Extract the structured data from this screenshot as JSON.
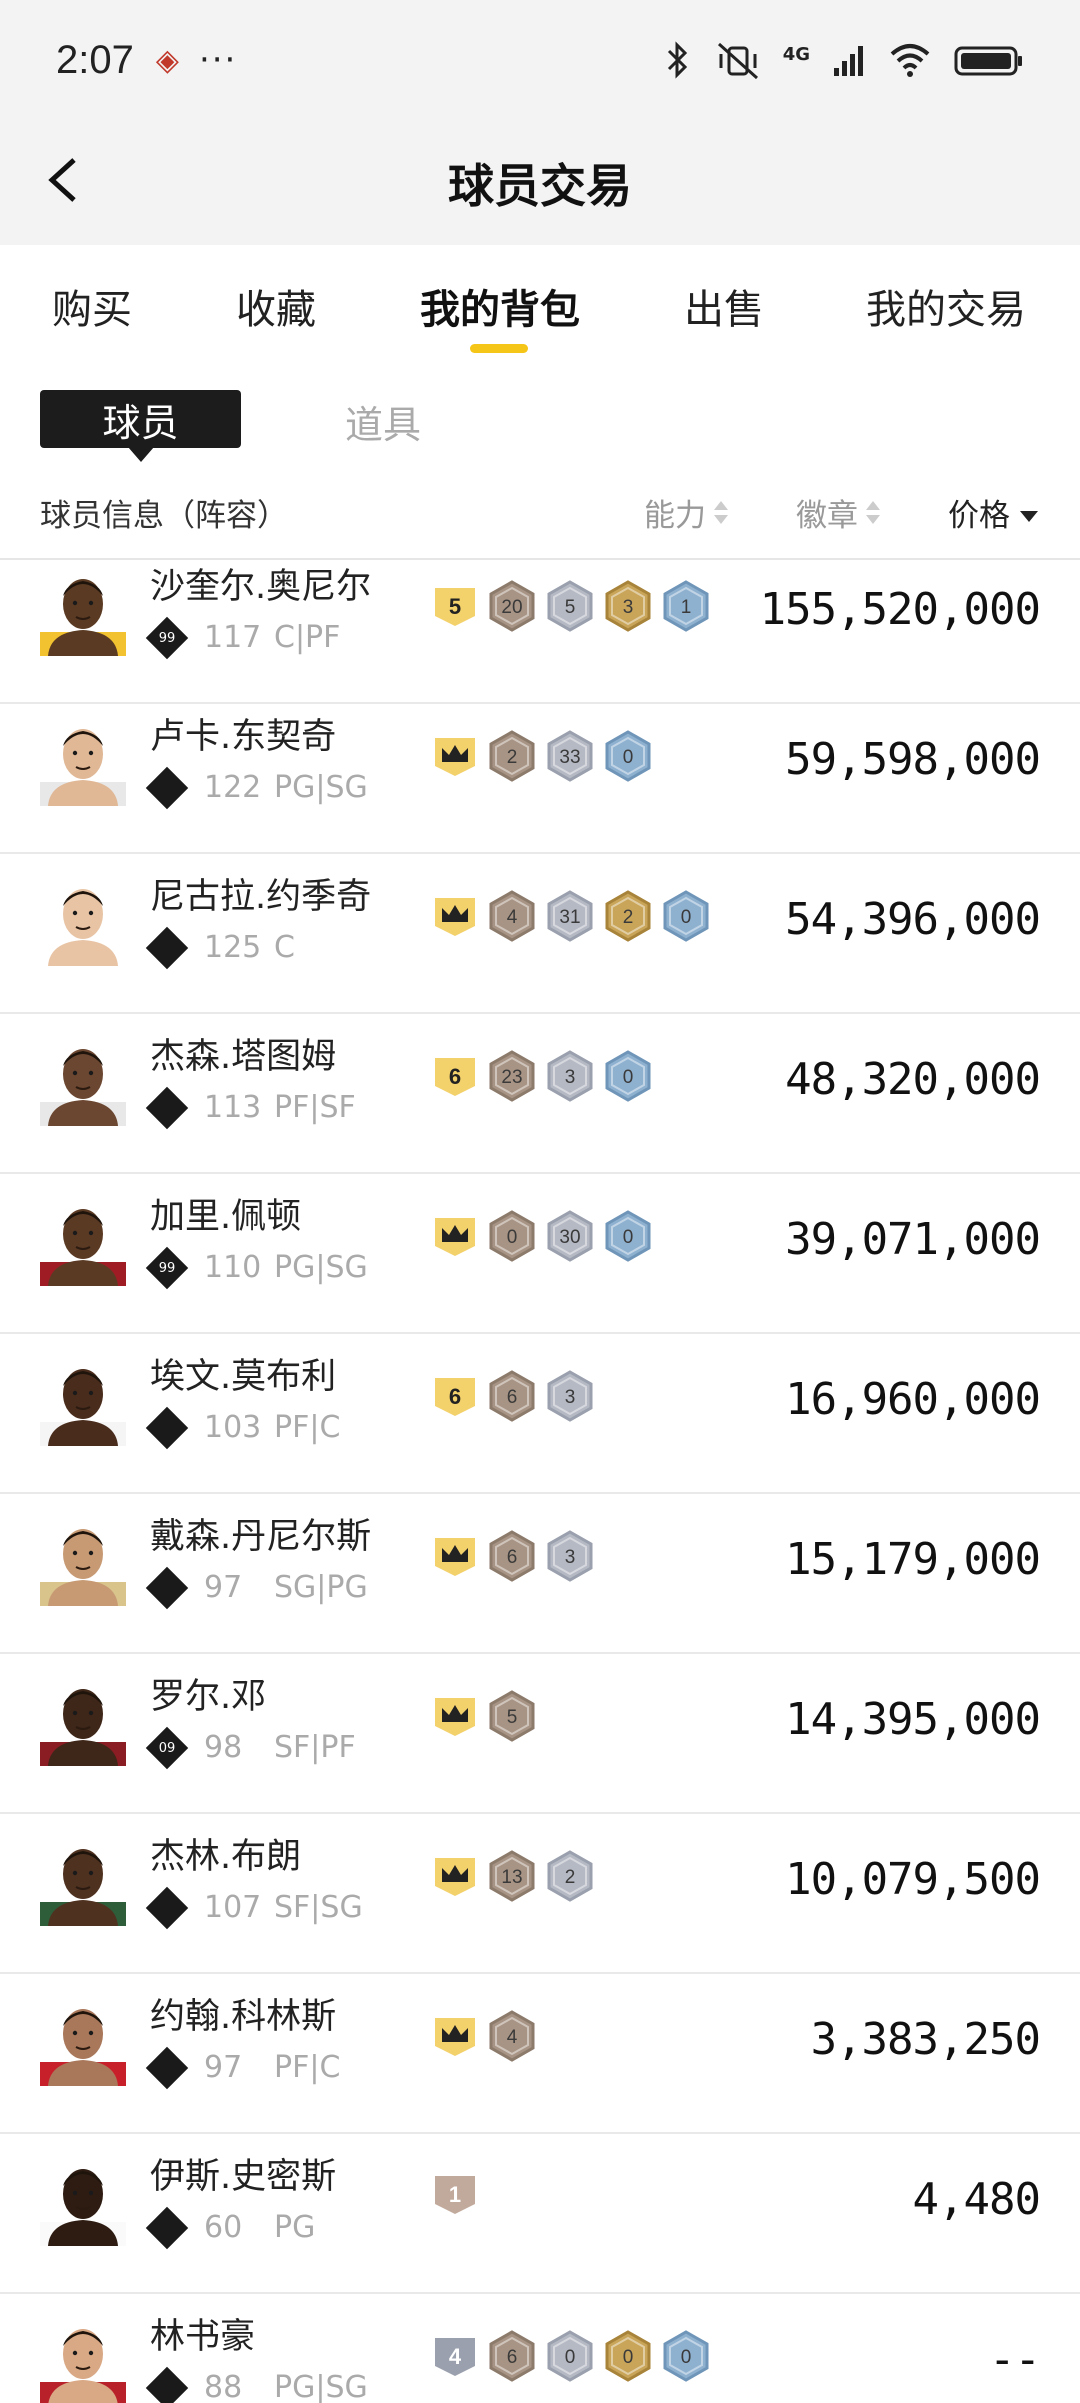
{
  "status": {
    "time": "2:07",
    "dots": "···",
    "network": "4G"
  },
  "topbar": {
    "title": "球员交易"
  },
  "tabs": [
    {
      "label": "购买"
    },
    {
      "label": "收藏"
    },
    {
      "label": "我的背包"
    },
    {
      "label": "出售"
    },
    {
      "label": "我的交易"
    }
  ],
  "subtabs": {
    "active": "球员",
    "other": "道具"
  },
  "columns": {
    "info": "球员信息（阵容）",
    "ability": "能力",
    "badge": "徽章",
    "price": "价格"
  },
  "colors": {
    "accent": "#f5c518",
    "gold": "#c9a55a",
    "bronze": "#a89484",
    "silver": "#b5b9c4",
    "blue": "#8fb1d0"
  },
  "players": [
    {
      "name": "沙奎尔.奥尼尔",
      "tier": "99",
      "ovr": "117",
      "pos": "C|PF",
      "rank": "5",
      "badges": [
        "20",
        "5",
        "3",
        "1"
      ],
      "price": "155,520,000"
    },
    {
      "name": "卢卡.东契奇",
      "tier": "",
      "ovr": "122",
      "pos": "PG|SG",
      "rank": "crown",
      "badges": [
        "2",
        "33",
        "0"
      ],
      "price": "59,598,000"
    },
    {
      "name": "尼古拉.约季奇",
      "tier": "",
      "ovr": "125",
      "pos": "C",
      "rank": "crown",
      "badges": [
        "4",
        "31",
        "2",
        "0"
      ],
      "price": "54,396,000"
    },
    {
      "name": "杰森.塔图姆",
      "tier": "",
      "ovr": "113",
      "pos": "PF|SF",
      "rank": "6",
      "badges": [
        "23",
        "3",
        "0"
      ],
      "price": "48,320,000"
    },
    {
      "name": "加里.佩顿",
      "tier": "99",
      "ovr": "110",
      "pos": "PG|SG",
      "rank": "crown",
      "badges": [
        "0",
        "30",
        "0"
      ],
      "price": "39,071,000"
    },
    {
      "name": "埃文.莫布利",
      "tier": "",
      "ovr": "103",
      "pos": "PF|C",
      "rank": "6",
      "badges": [
        "6",
        "3"
      ],
      "price": "16,960,000"
    },
    {
      "name": "戴森.丹尼尔斯",
      "tier": "",
      "ovr": "97",
      "pos": "SG|PG",
      "rank": "crown",
      "badges": [
        "6",
        "3"
      ],
      "price": "15,179,000"
    },
    {
      "name": "罗尔.邓",
      "tier": "09",
      "ovr": "98",
      "pos": "SF|PF",
      "rank": "crown",
      "badges": [
        "5"
      ],
      "price": "14,395,000"
    },
    {
      "name": "杰林.布朗",
      "tier": "",
      "ovr": "107",
      "pos": "SF|SG",
      "rank": "crown",
      "badges": [
        "13",
        "2"
      ],
      "price": "10,079,500"
    },
    {
      "name": "约翰.科林斯",
      "tier": "",
      "ovr": "97",
      "pos": "PF|C",
      "rank": "crown",
      "badges": [
        "4"
      ],
      "price": "3,383,250"
    },
    {
      "name": "伊斯.史密斯",
      "tier": "",
      "ovr": "60",
      "pos": "PG",
      "rank": "1",
      "badges": [],
      "price": "4,480"
    },
    {
      "name": "林书豪",
      "tier": "",
      "ovr": "88",
      "pos": "PG|SG",
      "rank": "4",
      "badges": [
        "6",
        "0",
        "0",
        "0"
      ],
      "price": "--"
    }
  ]
}
